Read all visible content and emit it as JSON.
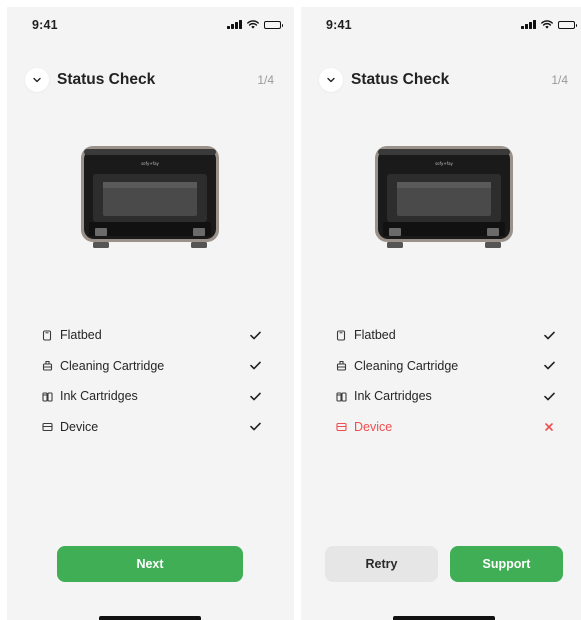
{
  "colors": {
    "primary_green": "#3fae54",
    "error_red": "#ee4e4e",
    "screen_bg": "#f4f4f4",
    "secondary_button_bg": "#e6e6e6"
  },
  "screens": [
    {
      "status_bar": {
        "time": "9:41",
        "icons": [
          "signal-icon",
          "wifi-icon",
          "battery-icon"
        ]
      },
      "header": {
        "back_icon": "chevron-down-icon",
        "title": "Status Check",
        "step": "1/4"
      },
      "device_image": {
        "brand": "sofy+fay"
      },
      "items": [
        {
          "label": "Flatbed",
          "icon": "flatbed-icon",
          "status": "ok"
        },
        {
          "label": "Cleaning Cartridge",
          "icon": "cleaning-cartridge-icon",
          "status": "ok"
        },
        {
          "label": "Ink Cartridges",
          "icon": "ink-cartridges-icon",
          "status": "ok"
        },
        {
          "label": "Device",
          "icon": "device-icon",
          "status": "ok"
        }
      ],
      "buttons": {
        "next": "Next"
      }
    },
    {
      "status_bar": {
        "time": "9:41",
        "icons": [
          "signal-icon",
          "wifi-icon",
          "battery-icon"
        ]
      },
      "header": {
        "back_icon": "chevron-down-icon",
        "title": "Status Check",
        "step": "1/4"
      },
      "device_image": {
        "brand": "sofy+fay"
      },
      "items": [
        {
          "label": "Flatbed",
          "icon": "flatbed-icon",
          "status": "ok"
        },
        {
          "label": "Cleaning Cartridge",
          "icon": "cleaning-cartridge-icon",
          "status": "ok"
        },
        {
          "label": "Ink Cartridges",
          "icon": "ink-cartridges-icon",
          "status": "ok"
        },
        {
          "label": "Device",
          "icon": "device-icon",
          "status": "error"
        }
      ],
      "buttons": {
        "retry": "Retry",
        "support": "Support"
      }
    }
  ]
}
